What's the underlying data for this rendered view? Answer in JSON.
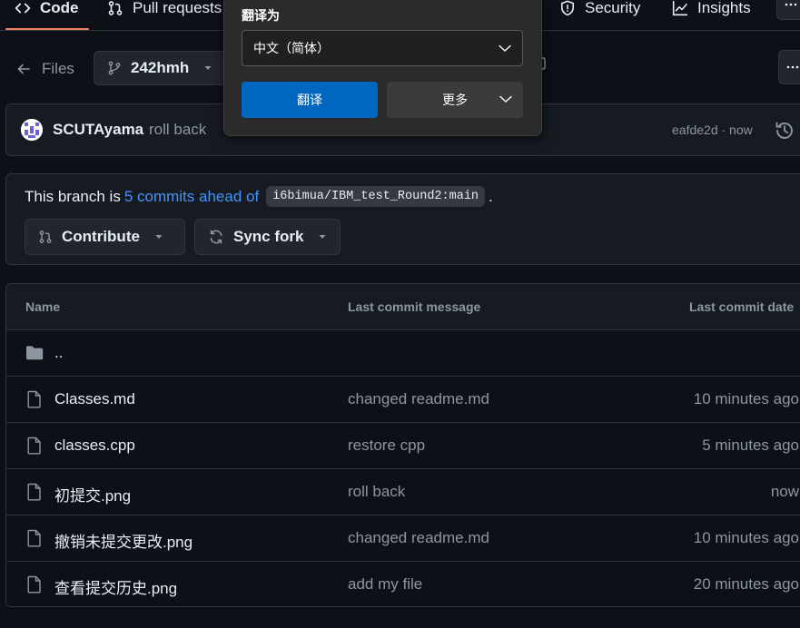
{
  "nav": {
    "tabs": [
      {
        "label": "Code",
        "icon": "code-icon",
        "active": true
      },
      {
        "label": "Pull requests",
        "icon": "git-pull-request-icon"
      },
      {
        "label": "Security",
        "icon": "shield-icon"
      },
      {
        "label": "Insights",
        "icon": "graph-icon"
      }
    ]
  },
  "files_nav": {
    "back_label": "Files",
    "branch": "242hmh"
  },
  "commit": {
    "author": "SCUTAyama",
    "message": "roll back",
    "sha_time": "eafde2d · now"
  },
  "ahead": {
    "prefix": "This branch is",
    "link": "5 commits ahead of",
    "ref": "i6bimua/IBM_test_Round2:main",
    "suffix": ".",
    "contribute_label": "Contribute",
    "sync_label": "Sync fork"
  },
  "table": {
    "headers": {
      "name": "Name",
      "message": "Last commit message",
      "date": "Last commit date"
    },
    "parent_dir": "..",
    "rows": [
      {
        "name": "Classes.md",
        "message": "changed readme.md",
        "date": "10 minutes ago"
      },
      {
        "name": "classes.cpp",
        "message": "restore cpp",
        "date": "5 minutes ago"
      },
      {
        "name": "初提交.png",
        "message": "roll back",
        "date": "now"
      },
      {
        "name": "撤销未提交更改.png",
        "message": "changed readme.md",
        "date": "10 minutes ago"
      },
      {
        "name": "查看提交历史.png",
        "message": "add my file",
        "date": "20 minutes ago"
      }
    ]
  },
  "translate_popup": {
    "title": "翻译为",
    "language": "中文（简体）",
    "translate_label": "翻译",
    "more_label": "更多"
  },
  "colors": {
    "background": "#0d1117",
    "border": "#30363d",
    "link": "#4493f8",
    "accent_underline": "#f78166",
    "popup_primary": "#0067c0"
  }
}
